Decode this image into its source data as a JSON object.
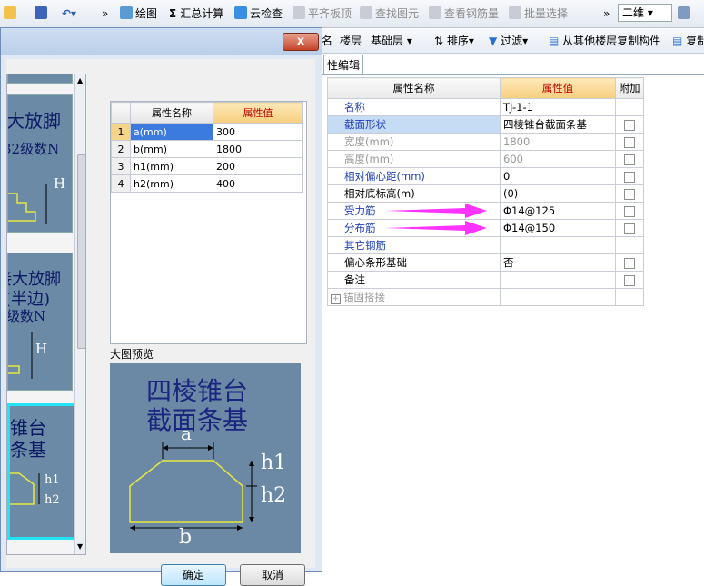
{
  "toolbar": {
    "draw": "绘图",
    "sum": "汇总计算",
    "cloud_check": "云检查",
    "flat_top": "平齐板顶",
    "find_element": "查找图元",
    "view_rebar": "查看钢筋量",
    "batch_select": "批量选择",
    "view_mode": "二维",
    "more": "»"
  },
  "toolbar2": {
    "layer_prefix": "名",
    "layer_label": "楼层",
    "layer_value": "基础层",
    "sort": "排序",
    "filter": "过滤",
    "copy_from_other": "从其他楼层复制构件",
    "copy_short": "复制"
  },
  "tab": {
    "label": "性编辑"
  },
  "property_grid": {
    "headers": [
      "属性名称",
      "属性值",
      "附加"
    ],
    "rows": [
      {
        "name": "名称",
        "value": "TJ-1-1",
        "style": "blue",
        "checkbox": false
      },
      {
        "name": "截面形状",
        "value": "四棱锥台截面条基",
        "style": "blue",
        "checkbox": true,
        "selected": true
      },
      {
        "name": "宽度(mm)",
        "value": "1800",
        "style": "gray",
        "checkbox": true
      },
      {
        "name": "高度(mm)",
        "value": "600",
        "style": "gray",
        "checkbox": true
      },
      {
        "name": "相对偏心距(mm)",
        "value": "0",
        "style": "blue",
        "checkbox": true
      },
      {
        "name": "相对底标高(m)",
        "value": "(0)",
        "style": "black",
        "checkbox": true
      },
      {
        "name": "受力筋",
        "value": "Φ14@125",
        "style": "blue",
        "checkbox": true
      },
      {
        "name": "分布筋",
        "value": "Φ14@150",
        "style": "blue",
        "checkbox": true
      },
      {
        "name": "其它钢筋",
        "value": "",
        "style": "blue",
        "checkbox": false
      },
      {
        "name": "偏心条形基础",
        "value": "否",
        "style": "black",
        "checkbox": true
      },
      {
        "name": "备注",
        "value": "",
        "style": "black",
        "checkbox": true
      },
      {
        "name": "锚固搭接",
        "value": "",
        "style": "gray",
        "checkbox": false,
        "expandable": true
      }
    ]
  },
  "dialog": {
    "thumbnails": [
      {
        "line1": "大放脚",
        "line2": "32级数N",
        "dim": "H"
      },
      {
        "line1": "接大放脚",
        "line2": "(半边)",
        "line3": "级数N",
        "dim": "H"
      },
      {
        "line1": "锥台",
        "line2": "条基",
        "dim1": "h1",
        "dim2": "h2"
      }
    ],
    "param_table": {
      "headers": [
        "属性名称",
        "属性值"
      ],
      "rows": [
        {
          "index": "1",
          "name": "a(mm)",
          "value": "300"
        },
        {
          "index": "2",
          "name": "b(mm)",
          "value": "1800"
        },
        {
          "index": "3",
          "name": "h1(mm)",
          "value": "200"
        },
        {
          "index": "4",
          "name": "h2(mm)",
          "value": "400"
        }
      ]
    },
    "preview_label": "大图预览",
    "preview": {
      "title_line1": "四棱锥台",
      "title_line2": "截面条基",
      "dim_a": "a",
      "dim_b": "b",
      "dim_h1": "h1",
      "dim_h2": "h2"
    },
    "ok_label": "确定",
    "cancel_label": "取消",
    "close_label": "x"
  },
  "colors": {
    "arrow": "#ff33ff",
    "preview_bg": "#6b89a5",
    "shape_outline": "#e8e840",
    "accent_header": "#f7cf7f"
  }
}
